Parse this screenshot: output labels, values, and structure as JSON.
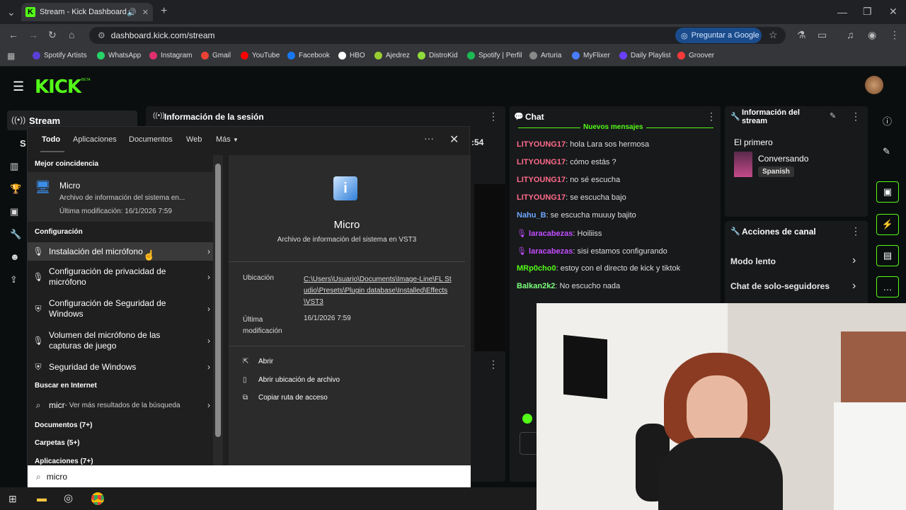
{
  "browser": {
    "tab_title": "Stream - Kick Dashboard",
    "url": "dashboard.kick.com/stream",
    "ask_google": "Preguntar a Google",
    "bookmarks": [
      "Spotify Artists",
      "WhatsApp",
      "Instagram",
      "Gmail",
      "YouTube",
      "Facebook",
      "HBO",
      "Ajedrez",
      "DistroKid",
      "Spotify | Perfil",
      "Arturia",
      "MyFlixer",
      "Daily Playlist",
      "Groover"
    ],
    "bookmark_colors": [
      "#5a3fd6",
      "#25d366",
      "#e1306c",
      "#ea4335",
      "#ff0000",
      "#1877f2",
      "#ffffff",
      "#9acd32",
      "#8fdc3c",
      "#1db954",
      "#888888",
      "#4a7cff",
      "#6a3fff",
      "#ff3a3a"
    ]
  },
  "kick": {
    "logo": "KICK",
    "logo_badge": "BETA",
    "nav_stream": "Stream",
    "session_title": "Información de la sesión",
    "session_value": ":54",
    "chat_title": "Chat",
    "new_messages": "Nuevos mensajes",
    "chat": [
      {
        "user": "LITYOUNG17",
        "color": "#ff6b8b",
        "text": ": hola Lara sos hermosa"
      },
      {
        "user": "LITYOUNG17",
        "color": "#ff6b8b",
        "text": ": cómo estás ?"
      },
      {
        "user": "LITYOUNG17",
        "color": "#ff6b8b",
        "text": ": no sé escucha"
      },
      {
        "user": "LITYOUNG17",
        "color": "#ff6b8b",
        "text": ": se escucha bajo"
      },
      {
        "user": "Nahu_B",
        "color": "#6fa8ff",
        "text": ": se escucha muuuy bajito"
      },
      {
        "user": "laracabezas",
        "color": "#c24dff",
        "text": ": Hoiliiss"
      },
      {
        "user": "laracabezas",
        "color": "#c24dff",
        "text": ": sisi estamos configurando"
      },
      {
        "user": "MRp0cho0",
        "color": "#53fc18",
        "text": ": estoy con el directo de kick y tiktok"
      },
      {
        "user": "Balkan2k2",
        "color": "#7cff7c",
        "text": ": No escucho nada"
      }
    ],
    "stream_info_title": "Información del stream",
    "stream_name": "El primero",
    "category": "Conversando",
    "language": "Spanish",
    "channel_actions_title": "Acciones de canal",
    "actions": [
      "Modo lento",
      "Chat de solo-seguidores"
    ]
  },
  "search": {
    "tabs": [
      "Todo",
      "Aplicaciones",
      "Documentos",
      "Web",
      "Más"
    ],
    "best_match_header": "Mejor coincidencia",
    "best_match": {
      "name": "Micro",
      "desc": "Archivo de información del sistema en...",
      "modified": "Última modificación: 16/1/2026 7:59"
    },
    "config_header": "Configuración",
    "config_items": [
      "Instalación del micrófono",
      "Configuración de privacidad de micrófono",
      "Configuración de Seguridad de Windows",
      "Volumen del micrófono de las capturas de juego",
      "Seguridad de Windows"
    ],
    "internet_header": "Buscar en Internet",
    "internet_query": "micr",
    "internet_suffix": " - Ver más resultados de la búsqueda",
    "groups": [
      "Documentos (7+)",
      "Carpetas (5+)",
      "Aplicaciones (7+)"
    ],
    "detail": {
      "name": "Micro",
      "desc": "Archivo de información del sistema en VST3",
      "location_label": "Ubicación",
      "location_value": "C:\\Users\\Usuario\\Documents\\Image-Line\\FL Studio\\Presets\\Plugin database\\Installed\\Effects\\VST3",
      "modified_label": "Última modificación",
      "modified_value": "16/1/2026 7:59",
      "actions": [
        "Abrir",
        "Abrir ubicación de archivo",
        "Copiar ruta de acceso"
      ]
    },
    "query": "micro"
  }
}
